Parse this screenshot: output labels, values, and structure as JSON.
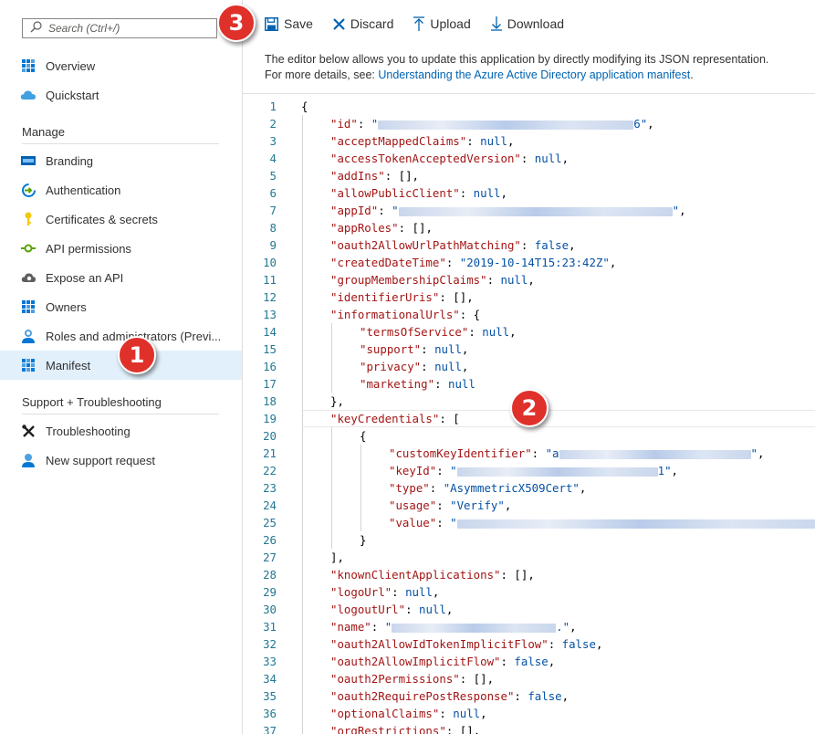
{
  "search": {
    "placeholder": "Search (Ctrl+/)"
  },
  "sidebar": {
    "items_top": [
      {
        "label": "Overview",
        "icon": "overview-grid-icon"
      },
      {
        "label": "Quickstart",
        "icon": "cloud-icon"
      }
    ],
    "manage_title": "Manage",
    "manage_items": [
      {
        "label": "Branding",
        "icon": "branding-icon"
      },
      {
        "label": "Authentication",
        "icon": "authentication-icon"
      },
      {
        "label": "Certificates & secrets",
        "icon": "key-icon"
      },
      {
        "label": "API permissions",
        "icon": "api-permissions-icon"
      },
      {
        "label": "Expose an API",
        "icon": "cloud-gear-icon"
      },
      {
        "label": "Owners",
        "icon": "owners-grid-icon"
      },
      {
        "label": "Roles and administrators (Previ...",
        "icon": "roles-user-icon"
      },
      {
        "label": "Manifest",
        "icon": "manifest-icon",
        "active": true
      }
    ],
    "support_title": "Support + Troubleshooting",
    "support_items": [
      {
        "label": "Troubleshooting",
        "icon": "tools-icon"
      },
      {
        "label": "New support request",
        "icon": "support-user-icon"
      }
    ]
  },
  "toolbar": {
    "save": "Save",
    "discard": "Discard",
    "upload": "Upload",
    "download": "Download"
  },
  "description": {
    "line1": "The editor below allows you to update this application by directly modifying its JSON representation.",
    "line2_prefix": "For more details, see: ",
    "link": "Understanding the Azure Active Directory application manifest",
    "line2_suffix": "."
  },
  "badges": [
    "1",
    "2",
    "3"
  ],
  "colors": {
    "accent": "#0078d4",
    "badge": "#e0302a",
    "active_bg": "#e1f0fb",
    "key": "#a31515",
    "value": "#0451a5"
  },
  "editor_lines": [
    {
      "n": "1",
      "i": 0,
      "t": [
        [
          "p",
          "{"
        ]
      ]
    },
    {
      "n": "2",
      "i": 1,
      "t": [
        [
          "k",
          "\"id\""
        ],
        [
          "p",
          ": "
        ],
        [
          "s",
          "\""
        ],
        [
          "b",
          280
        ],
        [
          "s",
          "6\""
        ],
        [
          "p",
          ","
        ]
      ]
    },
    {
      "n": "3",
      "i": 1,
      "t": [
        [
          "k",
          "\"acceptMappedClaims\""
        ],
        [
          "p",
          ": "
        ],
        [
          "kw",
          "null"
        ],
        [
          "p",
          ","
        ]
      ]
    },
    {
      "n": "4",
      "i": 1,
      "t": [
        [
          "k",
          "\"accessTokenAcceptedVersion\""
        ],
        [
          "p",
          ": "
        ],
        [
          "kw",
          "null"
        ],
        [
          "p",
          ","
        ]
      ]
    },
    {
      "n": "5",
      "i": 1,
      "t": [
        [
          "k",
          "\"addIns\""
        ],
        [
          "p",
          ": [],"
        ]
      ]
    },
    {
      "n": "6",
      "i": 1,
      "t": [
        [
          "k",
          "\"allowPublicClient\""
        ],
        [
          "p",
          ": "
        ],
        [
          "kw",
          "null"
        ],
        [
          "p",
          ","
        ]
      ]
    },
    {
      "n": "7",
      "i": 1,
      "t": [
        [
          "k",
          "\"appId\""
        ],
        [
          "p",
          ": "
        ],
        [
          "s",
          "\""
        ],
        [
          "b",
          300
        ],
        [
          "s",
          "\""
        ],
        [
          "p",
          ","
        ]
      ]
    },
    {
      "n": "8",
      "i": 1,
      "t": [
        [
          "k",
          "\"appRoles\""
        ],
        [
          "p",
          ": [],"
        ]
      ]
    },
    {
      "n": "9",
      "i": 1,
      "t": [
        [
          "k",
          "\"oauth2AllowUrlPathMatching\""
        ],
        [
          "p",
          ": "
        ],
        [
          "kw",
          "false"
        ],
        [
          "p",
          ","
        ]
      ]
    },
    {
      "n": "10",
      "i": 1,
      "t": [
        [
          "k",
          "\"createdDateTime\""
        ],
        [
          "p",
          ": "
        ],
        [
          "s",
          "\"2019-10-14T15:23:42Z\""
        ],
        [
          "p",
          ","
        ]
      ]
    },
    {
      "n": "11",
      "i": 1,
      "t": [
        [
          "k",
          "\"groupMembershipClaims\""
        ],
        [
          "p",
          ": "
        ],
        [
          "kw",
          "null"
        ],
        [
          "p",
          ","
        ]
      ]
    },
    {
      "n": "12",
      "i": 1,
      "t": [
        [
          "k",
          "\"identifierUris\""
        ],
        [
          "p",
          ": [],"
        ]
      ]
    },
    {
      "n": "13",
      "i": 1,
      "t": [
        [
          "k",
          "\"informationalUrls\""
        ],
        [
          "p",
          ": {"
        ]
      ]
    },
    {
      "n": "14",
      "i": 2,
      "t": [
        [
          "k",
          "\"termsOfService\""
        ],
        [
          "p",
          ": "
        ],
        [
          "kw",
          "null"
        ],
        [
          "p",
          ","
        ]
      ]
    },
    {
      "n": "15",
      "i": 2,
      "t": [
        [
          "k",
          "\"support\""
        ],
        [
          "p",
          ": "
        ],
        [
          "kw",
          "null"
        ],
        [
          "p",
          ","
        ]
      ]
    },
    {
      "n": "16",
      "i": 2,
      "t": [
        [
          "k",
          "\"privacy\""
        ],
        [
          "p",
          ": "
        ],
        [
          "kw",
          "null"
        ],
        [
          "p",
          ","
        ]
      ]
    },
    {
      "n": "17",
      "i": 2,
      "t": [
        [
          "k",
          "\"marketing\""
        ],
        [
          "p",
          ": "
        ],
        [
          "kw",
          "null"
        ]
      ]
    },
    {
      "n": "18",
      "i": 1,
      "t": [
        [
          "p",
          "},"
        ]
      ]
    },
    {
      "n": "19",
      "i": 1,
      "t": [
        [
          "k",
          "\"keyCredentials\""
        ],
        [
          "p",
          ": ["
        ]
      ]
    },
    {
      "n": "20",
      "i": 2,
      "t": [
        [
          "p",
          "{"
        ]
      ]
    },
    {
      "n": "21",
      "i": 3,
      "t": [
        [
          "k",
          "\"customKeyIdentifier\""
        ],
        [
          "p",
          ": "
        ],
        [
          "s",
          "\"a"
        ],
        [
          "b",
          210
        ],
        [
          "s",
          "\""
        ],
        [
          "p",
          ","
        ]
      ]
    },
    {
      "n": "22",
      "i": 3,
      "t": [
        [
          "k",
          "\"keyId\""
        ],
        [
          "p",
          ": "
        ],
        [
          "s",
          "\""
        ],
        [
          "b",
          220
        ],
        [
          "s",
          "1\""
        ],
        [
          "p",
          ","
        ]
      ]
    },
    {
      "n": "23",
      "i": 3,
      "t": [
        [
          "k",
          "\"type\""
        ],
        [
          "p",
          ": "
        ],
        [
          "s",
          "\"AsymmetricX509Cert\""
        ],
        [
          "p",
          ","
        ]
      ]
    },
    {
      "n": "24",
      "i": 3,
      "t": [
        [
          "k",
          "\"usage\""
        ],
        [
          "p",
          ": "
        ],
        [
          "s",
          "\"Verify\""
        ],
        [
          "p",
          ","
        ]
      ]
    },
    {
      "n": "25",
      "i": 3,
      "t": [
        [
          "k",
          "\"value\""
        ],
        [
          "p",
          ": "
        ],
        [
          "s",
          "\""
        ],
        [
          "b",
          400
        ]
      ]
    },
    {
      "n": "26",
      "i": 2,
      "t": [
        [
          "p",
          "}"
        ]
      ]
    },
    {
      "n": "27",
      "i": 1,
      "t": [
        [
          "p",
          "],"
        ]
      ]
    },
    {
      "n": "28",
      "i": 1,
      "t": [
        [
          "k",
          "\"knownClientApplications\""
        ],
        [
          "p",
          ": [],"
        ]
      ]
    },
    {
      "n": "29",
      "i": 1,
      "t": [
        [
          "k",
          "\"logoUrl\""
        ],
        [
          "p",
          ": "
        ],
        [
          "kw",
          "null"
        ],
        [
          "p",
          ","
        ]
      ]
    },
    {
      "n": "30",
      "i": 1,
      "t": [
        [
          "k",
          "\"logoutUrl\""
        ],
        [
          "p",
          ": "
        ],
        [
          "kw",
          "null"
        ],
        [
          "p",
          ","
        ]
      ]
    },
    {
      "n": "31",
      "i": 1,
      "t": [
        [
          "k",
          "\"name\""
        ],
        [
          "p",
          ": "
        ],
        [
          "s",
          "\""
        ],
        [
          "b",
          180
        ],
        [
          "s",
          ".\""
        ],
        [
          "p",
          ","
        ]
      ]
    },
    {
      "n": "32",
      "i": 1,
      "t": [
        [
          "k",
          "\"oauth2AllowIdTokenImplicitFlow\""
        ],
        [
          "p",
          ": "
        ],
        [
          "kw",
          "false"
        ],
        [
          "p",
          ","
        ]
      ]
    },
    {
      "n": "33",
      "i": 1,
      "t": [
        [
          "k",
          "\"oauth2AllowImplicitFlow\""
        ],
        [
          "p",
          ": "
        ],
        [
          "kw",
          "false"
        ],
        [
          "p",
          ","
        ]
      ]
    },
    {
      "n": "34",
      "i": 1,
      "t": [
        [
          "k",
          "\"oauth2Permissions\""
        ],
        [
          "p",
          ": [],"
        ]
      ]
    },
    {
      "n": "35",
      "i": 1,
      "t": [
        [
          "k",
          "\"oauth2RequirePostResponse\""
        ],
        [
          "p",
          ": "
        ],
        [
          "kw",
          "false"
        ],
        [
          "p",
          ","
        ]
      ]
    },
    {
      "n": "36",
      "i": 1,
      "t": [
        [
          "k",
          "\"optionalClaims\""
        ],
        [
          "p",
          ": "
        ],
        [
          "kw",
          "null"
        ],
        [
          "p",
          ","
        ]
      ]
    },
    {
      "n": "37",
      "i": 1,
      "t": [
        [
          "k",
          "\"orgRestrictions\""
        ],
        [
          "p",
          ": [],"
        ]
      ]
    }
  ]
}
